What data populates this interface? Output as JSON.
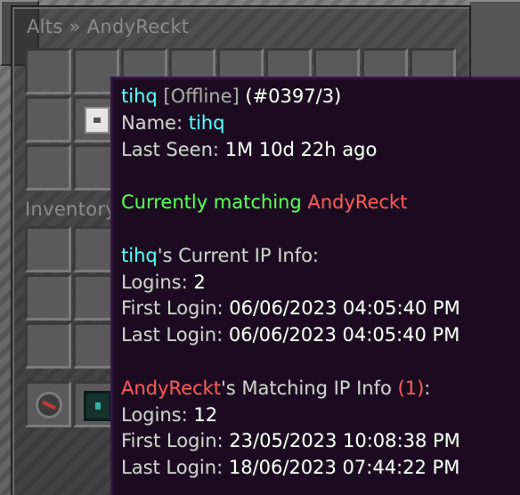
{
  "panel": {
    "title": "Alts » AndyReckt",
    "inventory_title": "Inventory",
    "alts_slots": [
      "",
      "",
      "",
      "",
      "",
      "",
      "",
      "",
      "",
      "",
      "player-head",
      "",
      "",
      "",
      "",
      "",
      "",
      "",
      "",
      "",
      "",
      "",
      "",
      "",
      "",
      "",
      ""
    ],
    "hotbar": [
      "compass",
      "ender-chest",
      "",
      "",
      "",
      "",
      "",
      "",
      ""
    ]
  },
  "tooltip": {
    "header": {
      "name": "tihq",
      "status": "[Offline]",
      "id": "(#0397/3)"
    },
    "name_label": "Name: ",
    "name_value": "tihq",
    "last_seen_label": "Last Seen: ",
    "last_seen_value": "1M 10d 22h ago",
    "matching_label": "Currently matching ",
    "matching_value": "AndyReckt",
    "current_ip": {
      "owner": "tihq",
      "heading_suffix": "'s Current IP Info:",
      "logins_label": "Logins: ",
      "logins_value": "2",
      "first_login_label": "First Login: ",
      "first_login_value": "06/06/2023 04:05:40 PM",
      "last_login_label": "Last Login: ",
      "last_login_value": "06/06/2023 04:05:40 PM"
    },
    "matching_ip": {
      "owner": "AndyReckt",
      "heading_suffix": "'s Matching IP Info ",
      "count": "(1)",
      "colon": ":",
      "logins_label": "Logins: ",
      "logins_value": "12",
      "first_login_label": "First Login: ",
      "first_login_value": "23/05/2023 10:08:38 PM",
      "last_login_label": "Last Login: ",
      "last_login_value": "18/06/2023 07:44:22 PM"
    }
  },
  "colors": {
    "aqua": "#55ffff",
    "green": "#55ff55",
    "red": "#ff5555",
    "gray": "#aaaaaa",
    "tooltip_bg": "#1b0a20",
    "tooltip_border": "#3a1450"
  }
}
